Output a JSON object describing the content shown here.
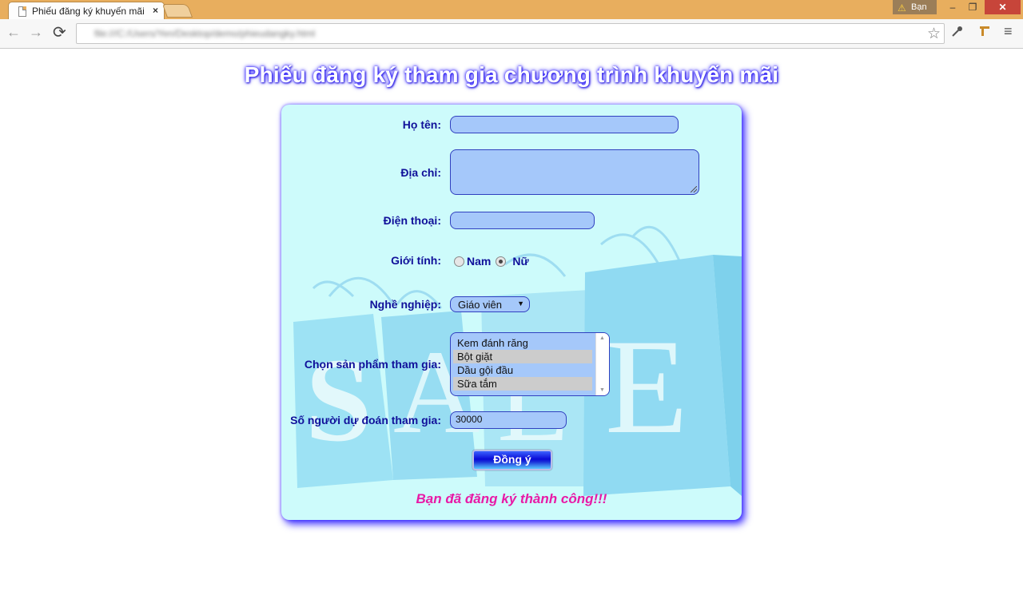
{
  "browser": {
    "tab_title": "Phiếu đăng ký khuyến mãi",
    "tab_close": "×",
    "url": "file:///C:/Users/Yen/Desktop/demo/phieudangky.html",
    "user_label": "Bạn",
    "nav": {
      "back": "←",
      "forward": "→",
      "reload": "⟳",
      "star": "☆",
      "menu": "≡"
    },
    "window": {
      "minimize": "–",
      "maximize": "❐",
      "close": "✕"
    }
  },
  "page": {
    "title": "Phiếu đăng ký tham gia chương trình khuyến mãi"
  },
  "form": {
    "name_label": "Họ tên:",
    "name_value": "",
    "address_label": "Địa chỉ:",
    "address_value": "",
    "phone_label": "Điện thoại:",
    "phone_value": "",
    "gender_label": "Giới tính:",
    "gender_options": [
      "Nam",
      "Nữ"
    ],
    "gender_selected": "Nữ",
    "job_label": "Nghề nghiệp:",
    "job_value": "Giáo viên",
    "products_label": "Chọn sản phẩm tham gia:",
    "products": [
      {
        "label": "Kem đánh răng",
        "selected": false
      },
      {
        "label": "Bột giặt",
        "selected": true
      },
      {
        "label": "Dầu gội đầu",
        "selected": false
      },
      {
        "label": "Sữa tắm",
        "selected": true
      }
    ],
    "guess_label": "Số người dự đoán tham gia:",
    "guess_value": "30000",
    "submit_label": "Đồng ý",
    "success_message": "Bạn đã đăng ký thành công!!!"
  },
  "colors": {
    "label": "#10109a",
    "input_bg": "#a5c8fa",
    "card_bg": "#cdfbfb",
    "success": "#e81aa6",
    "title_glow": "#3a2bff"
  },
  "background_art_text": "SALE"
}
